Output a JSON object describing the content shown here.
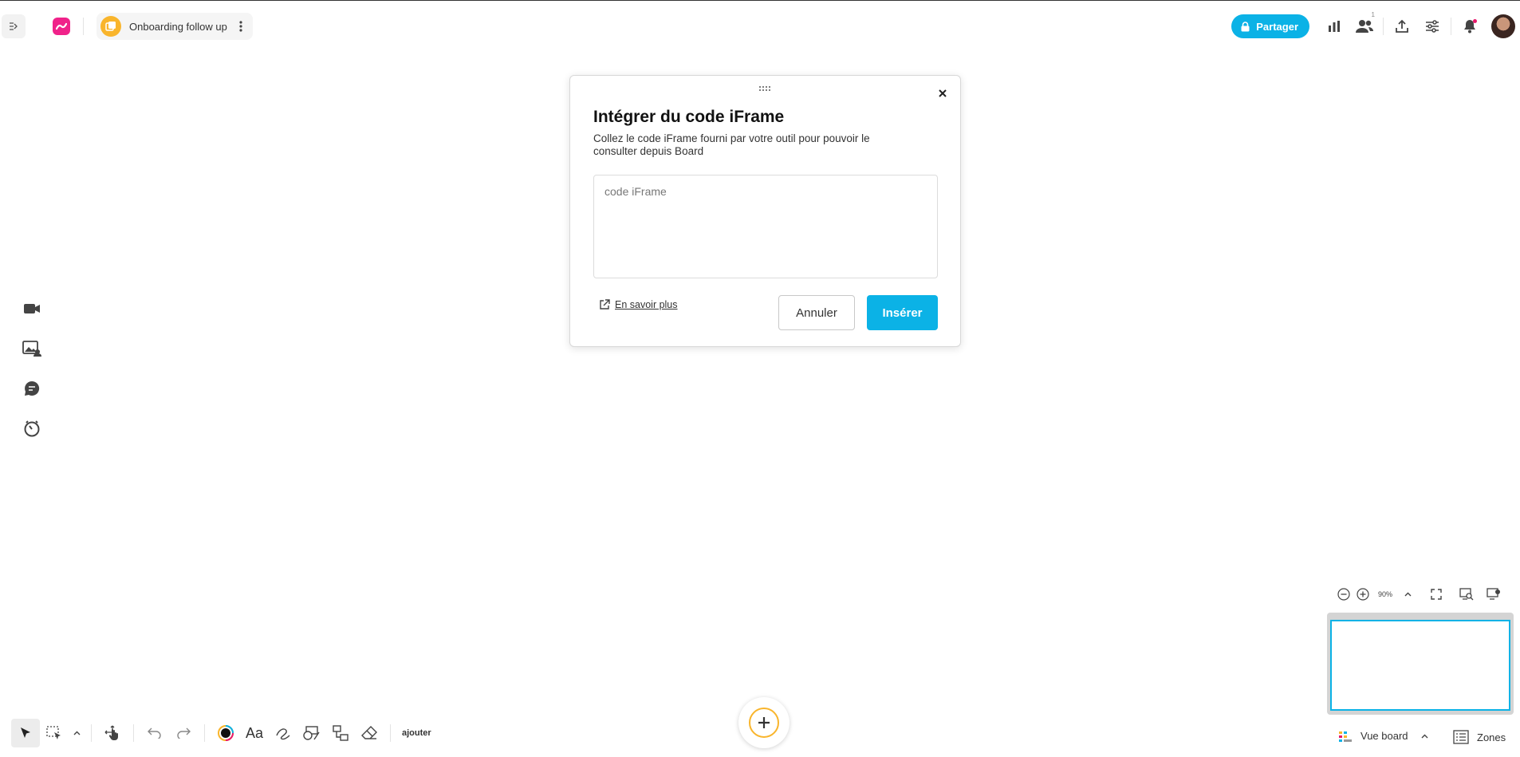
{
  "header": {
    "board_name": "Onboarding follow up",
    "share_label": "Partager",
    "collaborators_count": "1"
  },
  "modal": {
    "title": "Intégrer du code iFrame",
    "description": "Collez le code iFrame fourni par votre outil pour pouvoir le consulter depuis Board",
    "input_placeholder": "code iFrame",
    "input_value": "",
    "learn_more": "En savoir plus",
    "cancel_label": "Annuler",
    "insert_label": "Insérer"
  },
  "toolbar": {
    "text_tool_label": "Aa",
    "add_label": "ajouter"
  },
  "zoom": {
    "level": "90%"
  },
  "footer": {
    "view_board_label": "Vue board",
    "zones_label": "Zones"
  },
  "colors": {
    "accent": "#0bb2e6",
    "brand_pink": "#f0228a",
    "board_yellow": "#f9b52c",
    "notification_dot": "#e8186a"
  }
}
